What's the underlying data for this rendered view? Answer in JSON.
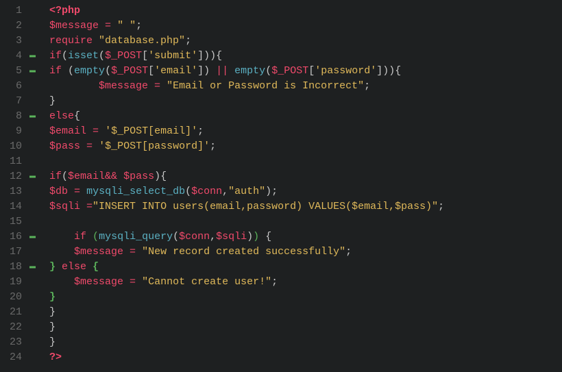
{
  "gutter": [
    {
      "num": "1",
      "fold": false
    },
    {
      "num": "2",
      "fold": false
    },
    {
      "num": "3",
      "fold": false
    },
    {
      "num": "4",
      "fold": true
    },
    {
      "num": "5",
      "fold": true
    },
    {
      "num": "6",
      "fold": false
    },
    {
      "num": "7",
      "fold": false
    },
    {
      "num": "8",
      "fold": true
    },
    {
      "num": "9",
      "fold": false
    },
    {
      "num": "10",
      "fold": false
    },
    {
      "num": "11",
      "fold": false
    },
    {
      "num": "12",
      "fold": true
    },
    {
      "num": "13",
      "fold": false
    },
    {
      "num": "14",
      "fold": false
    },
    {
      "num": "15",
      "fold": false
    },
    {
      "num": "16",
      "fold": true
    },
    {
      "num": "17",
      "fold": false
    },
    {
      "num": "18",
      "fold": true
    },
    {
      "num": "19",
      "fold": false
    },
    {
      "num": "20",
      "fold": false
    },
    {
      "num": "21",
      "fold": false
    },
    {
      "num": "22",
      "fold": false
    },
    {
      "num": "23",
      "fold": false
    },
    {
      "num": "24",
      "fold": false
    }
  ],
  "lines": [
    [
      {
        "cls": "t-tag",
        "t": "<?php"
      }
    ],
    [
      {
        "cls": "t-var",
        "t": "$message"
      },
      {
        "cls": "t-default",
        "t": " "
      },
      {
        "cls": "t-oper",
        "t": "="
      },
      {
        "cls": "t-default",
        "t": " "
      },
      {
        "cls": "t-string",
        "t": "\" \""
      },
      {
        "cls": "t-punct",
        "t": ";"
      }
    ],
    [
      {
        "cls": "t-keyword",
        "t": "require"
      },
      {
        "cls": "t-default",
        "t": " "
      },
      {
        "cls": "t-string",
        "t": "\"database.php\""
      },
      {
        "cls": "t-punct",
        "t": ";"
      }
    ],
    [
      {
        "cls": "t-keyword",
        "t": "if"
      },
      {
        "cls": "t-punct",
        "t": "("
      },
      {
        "cls": "t-func",
        "t": "isset"
      },
      {
        "cls": "t-punct",
        "t": "("
      },
      {
        "cls": "t-var",
        "t": "$_POST"
      },
      {
        "cls": "t-punct",
        "t": "["
      },
      {
        "cls": "t-string",
        "t": "'submit'"
      },
      {
        "cls": "t-punct",
        "t": "])){"
      }
    ],
    [
      {
        "cls": "t-keyword",
        "t": "if"
      },
      {
        "cls": "t-default",
        "t": " "
      },
      {
        "cls": "t-punct",
        "t": "("
      },
      {
        "cls": "t-func",
        "t": "empty"
      },
      {
        "cls": "t-punct",
        "t": "("
      },
      {
        "cls": "t-var",
        "t": "$_POST"
      },
      {
        "cls": "t-punct",
        "t": "["
      },
      {
        "cls": "t-string",
        "t": "'email'"
      },
      {
        "cls": "t-punct",
        "t": "]) "
      },
      {
        "cls": "t-oper",
        "t": "||"
      },
      {
        "cls": "t-default",
        "t": " "
      },
      {
        "cls": "t-func",
        "t": "empty"
      },
      {
        "cls": "t-punct",
        "t": "("
      },
      {
        "cls": "t-var",
        "t": "$_POST"
      },
      {
        "cls": "t-punct",
        "t": "["
      },
      {
        "cls": "t-string",
        "t": "'password'"
      },
      {
        "cls": "t-punct",
        "t": "])){"
      }
    ],
    [
      {
        "cls": "t-default",
        "t": "        "
      },
      {
        "cls": "t-var",
        "t": "$message"
      },
      {
        "cls": "t-default",
        "t": " "
      },
      {
        "cls": "t-oper",
        "t": "="
      },
      {
        "cls": "t-default",
        "t": " "
      },
      {
        "cls": "t-string",
        "t": "\"Email or Password is Incorrect\""
      },
      {
        "cls": "t-punct",
        "t": ";"
      }
    ],
    [
      {
        "cls": "t-punct",
        "t": "}"
      }
    ],
    [
      {
        "cls": "t-keyword",
        "t": "else"
      },
      {
        "cls": "t-punct",
        "t": "{"
      }
    ],
    [
      {
        "cls": "t-var",
        "t": "$email"
      },
      {
        "cls": "t-default",
        "t": " "
      },
      {
        "cls": "t-oper",
        "t": "="
      },
      {
        "cls": "t-default",
        "t": " "
      },
      {
        "cls": "t-string",
        "t": "'$_POST[email]'"
      },
      {
        "cls": "t-punct",
        "t": ";"
      }
    ],
    [
      {
        "cls": "t-var",
        "t": "$pass"
      },
      {
        "cls": "t-default",
        "t": " "
      },
      {
        "cls": "t-oper",
        "t": "="
      },
      {
        "cls": "t-default",
        "t": " "
      },
      {
        "cls": "t-string",
        "t": "'$_POST[password]'"
      },
      {
        "cls": "t-punct",
        "t": ";"
      }
    ],
    [],
    [
      {
        "cls": "t-keyword",
        "t": "if"
      },
      {
        "cls": "t-punct",
        "t": "("
      },
      {
        "cls": "t-var",
        "t": "$email"
      },
      {
        "cls": "t-oper",
        "t": "&&"
      },
      {
        "cls": "t-default",
        "t": " "
      },
      {
        "cls": "t-var",
        "t": "$pass"
      },
      {
        "cls": "t-punct",
        "t": "){"
      }
    ],
    [
      {
        "cls": "t-var",
        "t": "$db"
      },
      {
        "cls": "t-default",
        "t": " "
      },
      {
        "cls": "t-oper",
        "t": "="
      },
      {
        "cls": "t-default",
        "t": " "
      },
      {
        "cls": "t-func",
        "t": "mysqli_select_db"
      },
      {
        "cls": "t-punct",
        "t": "("
      },
      {
        "cls": "t-var",
        "t": "$conn"
      },
      {
        "cls": "t-punct",
        "t": ","
      },
      {
        "cls": "t-string",
        "t": "\"auth\""
      },
      {
        "cls": "t-punct",
        "t": ");"
      }
    ],
    [
      {
        "cls": "t-var",
        "t": "$sqli"
      },
      {
        "cls": "t-default",
        "t": " "
      },
      {
        "cls": "t-oper",
        "t": "="
      },
      {
        "cls": "t-string",
        "t": "\"INSERT INTO users(email,password) VALUES($email,$pass)\""
      },
      {
        "cls": "t-punct",
        "t": ";"
      }
    ],
    [],
    [
      {
        "cls": "t-default",
        "t": "    "
      },
      {
        "cls": "t-keyword",
        "t": "if"
      },
      {
        "cls": "t-default",
        "t": " "
      },
      {
        "cls": "t-paren-hl",
        "t": "("
      },
      {
        "cls": "t-func",
        "t": "mysqli_query"
      },
      {
        "cls": "t-punct",
        "t": "("
      },
      {
        "cls": "t-var",
        "t": "$conn"
      },
      {
        "cls": "t-punct",
        "t": ","
      },
      {
        "cls": "t-var",
        "t": "$sqli"
      },
      {
        "cls": "t-punct",
        "t": ")"
      },
      {
        "cls": "t-paren-hl",
        "t": ")"
      },
      {
        "cls": "t-default",
        "t": " "
      },
      {
        "cls": "t-punct",
        "t": "{"
      }
    ],
    [
      {
        "cls": "t-default",
        "t": "    "
      },
      {
        "cls": "t-var",
        "t": "$message"
      },
      {
        "cls": "t-default",
        "t": " "
      },
      {
        "cls": "t-oper",
        "t": "="
      },
      {
        "cls": "t-default",
        "t": " "
      },
      {
        "cls": "t-string",
        "t": "\"New record created successfully\""
      },
      {
        "cls": "t-punct",
        "t": ";"
      }
    ],
    [
      {
        "cls": "t-brace-hl",
        "t": "}"
      },
      {
        "cls": "t-default",
        "t": " "
      },
      {
        "cls": "t-keyword",
        "t": "else"
      },
      {
        "cls": "t-default",
        "t": " "
      },
      {
        "cls": "t-brace-hl",
        "t": "{"
      }
    ],
    [
      {
        "cls": "t-default",
        "t": "    "
      },
      {
        "cls": "t-var",
        "t": "$message"
      },
      {
        "cls": "t-default",
        "t": " "
      },
      {
        "cls": "t-oper",
        "t": "="
      },
      {
        "cls": "t-default",
        "t": " "
      },
      {
        "cls": "t-string",
        "t": "\"Cannot create user!\""
      },
      {
        "cls": "t-punct",
        "t": ";"
      }
    ],
    [
      {
        "cls": "t-brace-hl",
        "t": "}"
      }
    ],
    [
      {
        "cls": "t-punct",
        "t": "}"
      }
    ],
    [
      {
        "cls": "t-punct",
        "t": "}"
      }
    ],
    [
      {
        "cls": "t-punct",
        "t": "}"
      }
    ],
    [
      {
        "cls": "t-tag",
        "t": "?>"
      }
    ]
  ]
}
